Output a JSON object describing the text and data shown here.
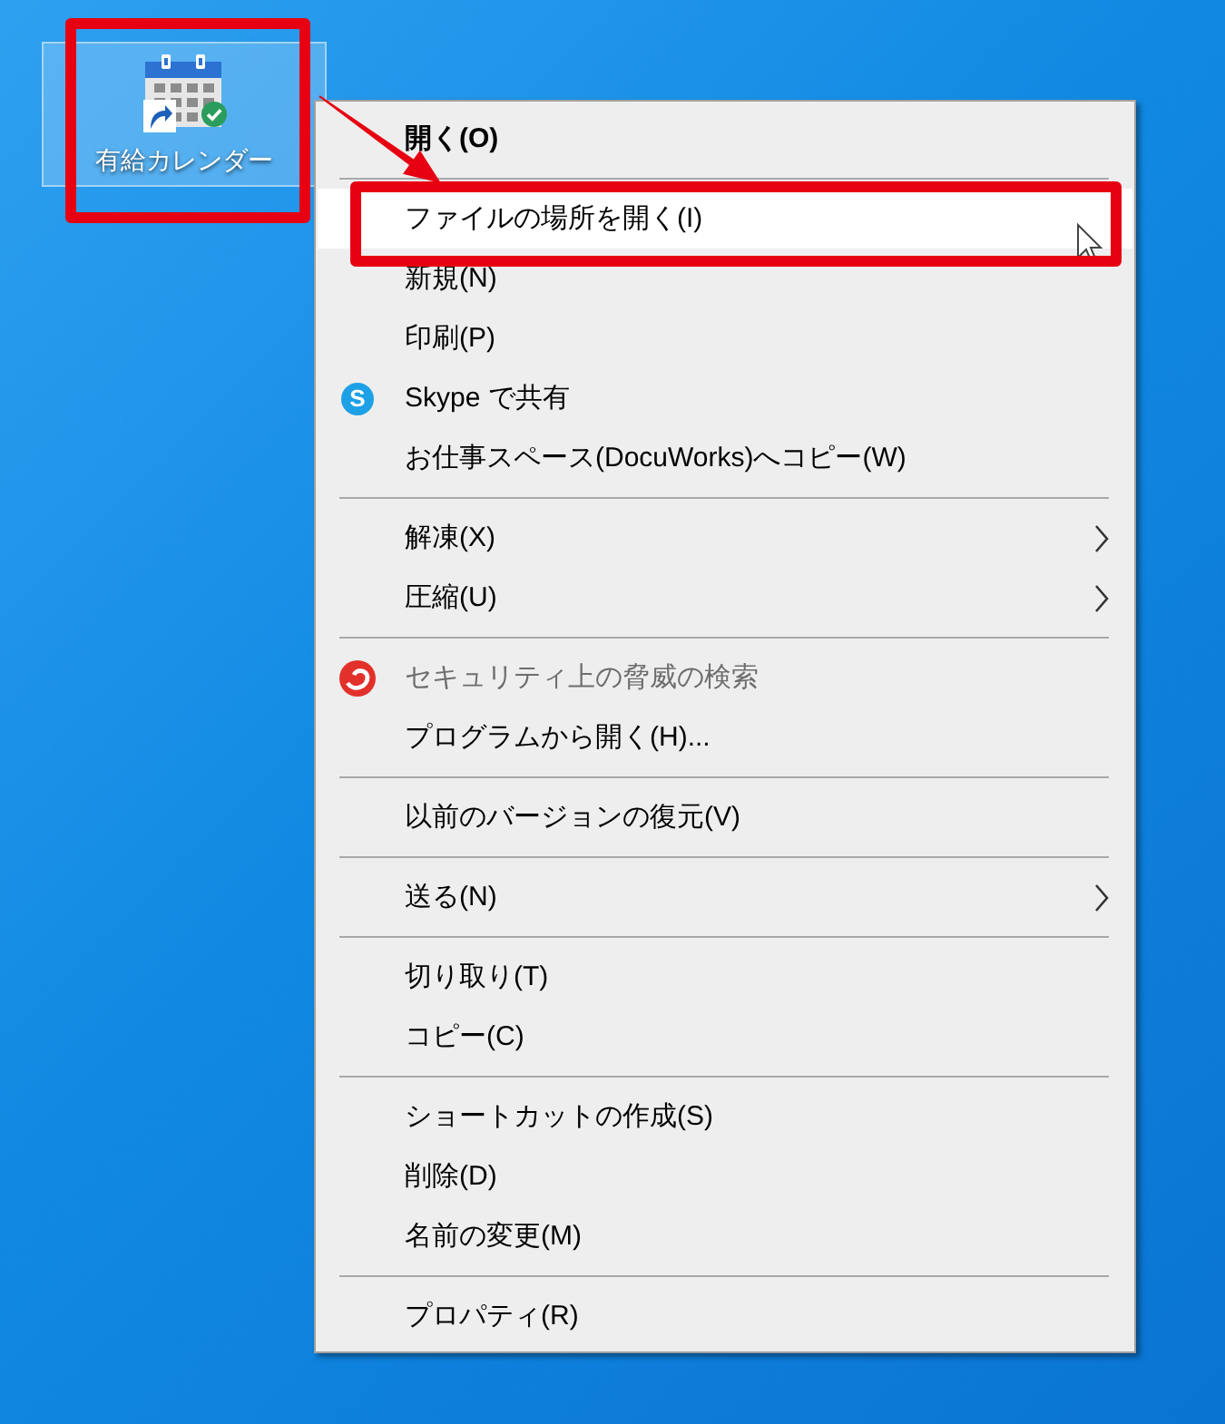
{
  "desktop_icon": {
    "label": "有給カレンダー",
    "selected": true
  },
  "context_menu": {
    "groups": [
      [
        {
          "label": "開く(O)",
          "kind": "plain",
          "default": true,
          "selected": false,
          "disabled": false,
          "submenu": false
        }
      ],
      [
        {
          "label": "ファイルの場所を開く(I)",
          "kind": "plain",
          "default": false,
          "selected": true,
          "disabled": false,
          "submenu": false
        },
        {
          "label": "新規(N)",
          "kind": "plain",
          "default": false,
          "selected": false,
          "disabled": false,
          "submenu": false
        },
        {
          "label": "印刷(P)",
          "kind": "plain",
          "default": false,
          "selected": false,
          "disabled": false,
          "submenu": false
        },
        {
          "label": "Skype で共有",
          "kind": "share",
          "icon_text": "S",
          "default": false,
          "selected": false,
          "disabled": false,
          "submenu": false
        },
        {
          "label": "お仕事スペース(DocuWorks)へコピー(W)",
          "kind": "plain",
          "default": false,
          "selected": false,
          "disabled": false,
          "submenu": false
        }
      ],
      [
        {
          "label": "解凍(X)",
          "kind": "plain",
          "default": false,
          "selected": false,
          "disabled": false,
          "submenu": true
        },
        {
          "label": "圧縮(U)",
          "kind": "plain",
          "default": false,
          "selected": false,
          "disabled": false,
          "submenu": true
        }
      ],
      [
        {
          "label": "セキュリティ上の脅威の検索",
          "kind": "scan",
          "default": false,
          "selected": false,
          "disabled": true,
          "submenu": false
        },
        {
          "label": "プログラムから開く(H)...",
          "kind": "plain",
          "default": false,
          "selected": false,
          "disabled": false,
          "submenu": false
        }
      ],
      [
        {
          "label": "以前のバージョンの復元(V)",
          "kind": "plain",
          "default": false,
          "selected": false,
          "disabled": false,
          "submenu": false
        }
      ],
      [
        {
          "label": "送る(N)",
          "kind": "plain",
          "default": false,
          "selected": false,
          "disabled": false,
          "submenu": true
        }
      ],
      [
        {
          "label": "切り取り(T)",
          "kind": "plain",
          "default": false,
          "selected": false,
          "disabled": false,
          "submenu": false
        },
        {
          "label": "コピー(C)",
          "kind": "plain",
          "default": false,
          "selected": false,
          "disabled": false,
          "submenu": false
        }
      ],
      [
        {
          "label": "ショートカットの作成(S)",
          "kind": "plain",
          "default": false,
          "selected": false,
          "disabled": false,
          "submenu": false
        },
        {
          "label": "削除(D)",
          "kind": "plain",
          "default": false,
          "selected": false,
          "disabled": false,
          "submenu": false
        },
        {
          "label": "名前の変更(M)",
          "kind": "plain",
          "default": false,
          "selected": false,
          "disabled": false,
          "submenu": false
        }
      ],
      [
        {
          "label": "プロパティ(R)",
          "kind": "plain",
          "default": false,
          "selected": false,
          "disabled": false,
          "submenu": false
        }
      ]
    ]
  }
}
